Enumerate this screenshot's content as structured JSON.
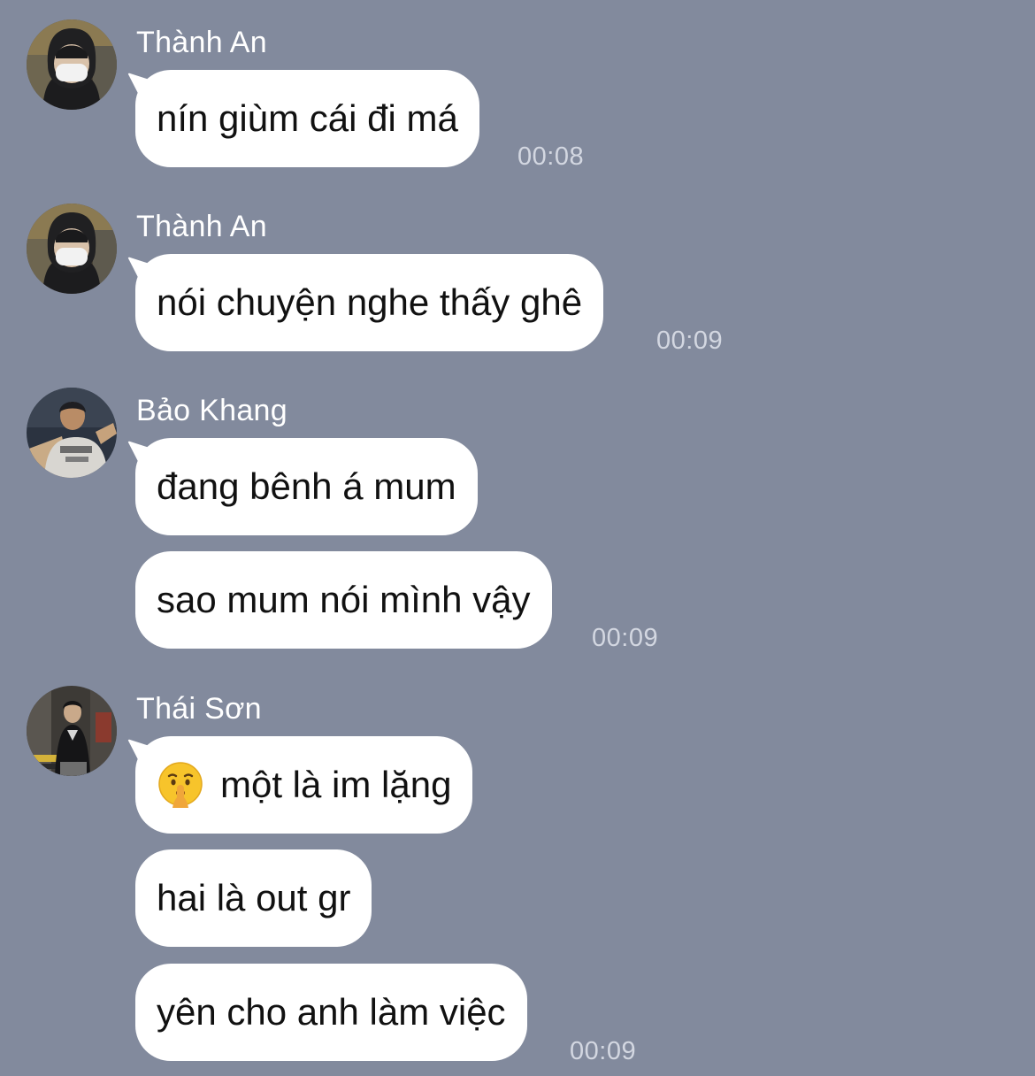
{
  "messages": [
    {
      "sender": "Thành An",
      "bubbles": [
        "nín giùm cái đi má"
      ],
      "time": "00:08"
    },
    {
      "sender": "Thành An",
      "bubbles": [
        "nói chuyện nghe thấy ghê"
      ],
      "time": "00:09"
    },
    {
      "sender": "Bảo Khang",
      "bubbles": [
        "đang bênh á mum",
        "sao mum nói mình vậy"
      ],
      "time": "00:09"
    },
    {
      "sender": "Thái Sơn",
      "bubbles": [
        "một là im lặng",
        "hai là out gr",
        "yên cho anh làm việc"
      ],
      "bubble_emoji": "shushing-face-emoji",
      "time": "00:09"
    }
  ]
}
